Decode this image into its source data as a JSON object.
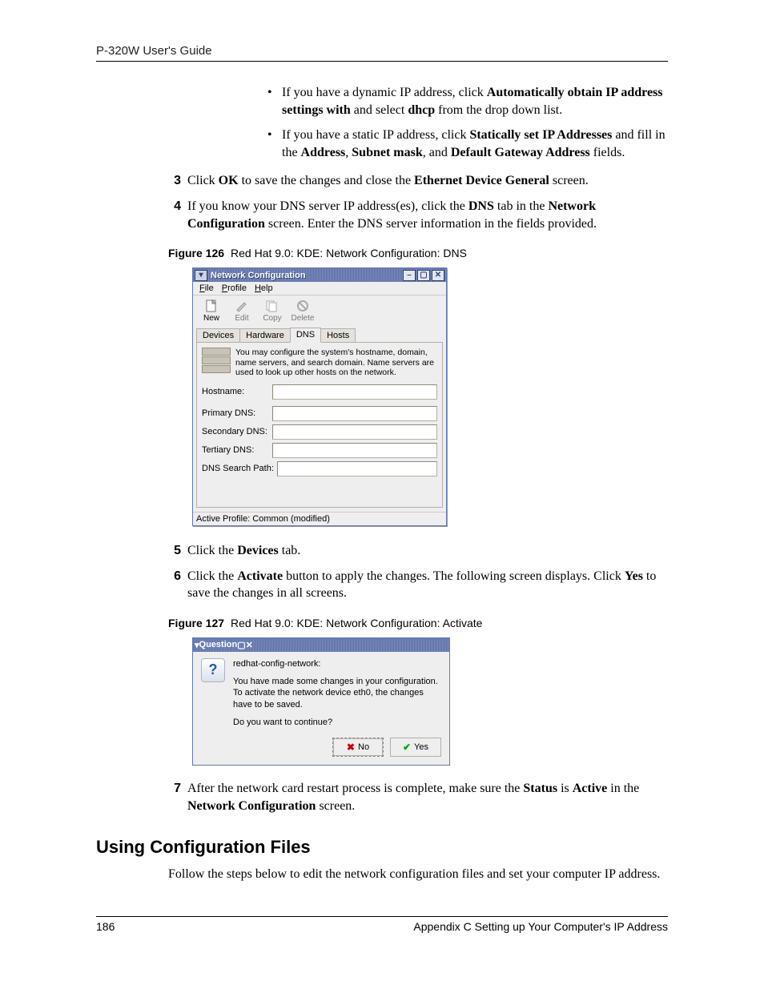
{
  "header": {
    "title": "P-320W User's Guide"
  },
  "bullets": [
    {
      "pre": "If you have a dynamic IP address, click ",
      "b1": "Automatically obtain IP address settings with",
      "mid1": " and select ",
      "b2": "dhcp",
      "post": " from the drop down list."
    },
    {
      "pre": "If you have a static IP address, click ",
      "b1": "Statically set IP Addresses",
      "mid1": " and fill in the  ",
      "b2": "Address",
      "mid2": ", ",
      "b3": "Subnet mask",
      "mid3": ", and ",
      "b4": "Default Gateway Address",
      "post": " fields."
    }
  ],
  "step3": {
    "num": "3",
    "pre": "Click ",
    "b1": "OK",
    "mid": " to save the changes and close the ",
    "b2": "Ethernet Device General",
    "post": " screen."
  },
  "step4": {
    "num": "4",
    "pre": "If you know your DNS server IP address(es), click the ",
    "b1": "DNS",
    "mid": " tab in the ",
    "b2": "Network Configuration",
    "post": " screen. Enter the DNS server information in the fields provided."
  },
  "fig126": {
    "label": "Figure 126",
    "caption": "Red Hat 9.0: KDE: Network Configuration: DNS"
  },
  "kde1": {
    "title": "Network Configuration",
    "menus": {
      "file": "File",
      "profile": "Profile",
      "help": "Help"
    },
    "tools": {
      "new": "New",
      "edit": "Edit",
      "copy": "Copy",
      "delete": "Delete"
    },
    "tabs": {
      "devices": "Devices",
      "hardware": "Hardware",
      "dns": "DNS",
      "hosts": "Hosts"
    },
    "desc": "You may configure the system's hostname, domain, name servers, and search domain. Name servers are used to look up other hosts on the network.",
    "labels": {
      "hostname": "Hostname:",
      "primary": "Primary DNS:",
      "secondary": "Secondary DNS:",
      "tertiary": "Tertiary DNS:",
      "search": "DNS Search Path:"
    },
    "status": "Active Profile: Common (modified)"
  },
  "step5": {
    "num": "5",
    "pre": "Click the ",
    "b1": "Devices",
    "post": " tab."
  },
  "step6": {
    "num": "6",
    "pre": "Click the ",
    "b1": "Activate",
    "mid": " button to apply the changes. The following screen displays. Click ",
    "b2": "Yes",
    "post": " to save the changes in all screens."
  },
  "fig127": {
    "label": "Figure 127",
    "caption": "Red Hat 9.0: KDE: Network Configuration: Activate"
  },
  "kde2": {
    "title": "Question",
    "line1": "redhat-config-network:",
    "line2": "You have made some changes in your configuration.",
    "line3": "To activate the network device eth0, the changes have to be saved.",
    "line4": "Do you want to continue?",
    "no": "No",
    "yes": "Yes"
  },
  "step7": {
    "num": "7",
    "pre": "After the network card restart process is complete, make sure the ",
    "b1": "Status",
    "mid": " is ",
    "b2": "Active",
    "mid2": " in the ",
    "b3": "Network Configuration",
    "post": " screen."
  },
  "section": {
    "heading": "Using Configuration Files",
    "body": "Follow the steps below to edit the network configuration files and set your computer IP address."
  },
  "footer": {
    "page": "186",
    "chapter": "Appendix C Setting up Your Computer's IP Address"
  }
}
